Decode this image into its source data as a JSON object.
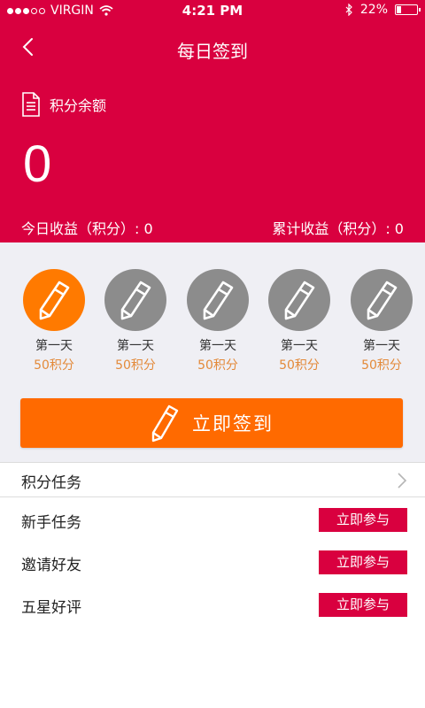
{
  "status_bar": {
    "carrier": "VIRGIN",
    "time": "4:21 PM",
    "battery": "22%",
    "battery_level": 0.22
  },
  "nav": {
    "title": "每日签到"
  },
  "balance": {
    "label": "积分余额",
    "value": "0"
  },
  "earnings": {
    "today": "今日收益（积分）: 0",
    "total": "累计收益（积分）: 0"
  },
  "days": [
    {
      "name": "第一天",
      "points": "50积分",
      "active": true
    },
    {
      "name": "第一天",
      "points": "50积分",
      "active": false
    },
    {
      "name": "第一天",
      "points": "50积分",
      "active": false
    },
    {
      "name": "第一天",
      "points": "50积分",
      "active": false
    },
    {
      "name": "第一天",
      "points": "50积分",
      "active": false
    }
  ],
  "sign_button": "立即签到",
  "tasks": {
    "header": "积分任务",
    "items": [
      {
        "label": "新手任务",
        "action": "立即参与"
      },
      {
        "label": "邀请好友",
        "action": "立即参与"
      },
      {
        "label": "五星好评",
        "action": "立即参与"
      }
    ]
  },
  "colors": {
    "brand_red": "#d9003f",
    "accent_orange": "#ff6a00",
    "day_gray": "#8c8c8c",
    "points_orange": "#e38a3a"
  }
}
